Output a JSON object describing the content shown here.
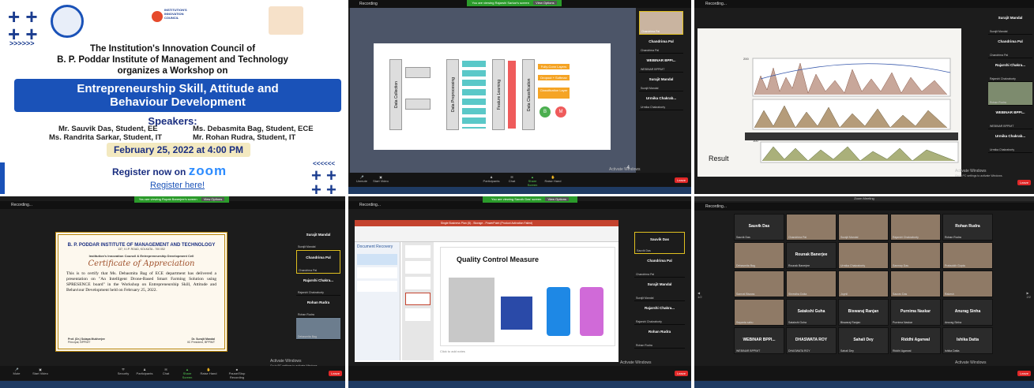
{
  "poster": {
    "title1": "The Institution's Innovation Council of",
    "title2": "B. P. Poddar Institute of Management and Technology",
    "title3": "organizes a Workshop on",
    "banner1": "Entrepreneurship Skill, Attitude and",
    "banner2": "Behaviour Development",
    "speakers_heading": "Speakers:",
    "speakers": [
      "Mr. Sauvik Das, Student, EE",
      "Ms. Debasmita Bag, Student, ECE",
      "Ms. Randrita Sarkar, Student, IT",
      "Mr. Rohan Rudra, Student, IT"
    ],
    "date": "February 25, 2022 at 4:00 PM",
    "register": "Register now on",
    "zoom": "zoom",
    "register_link": "Register here!",
    "iic_logo": "INSTITUTION'S INNOVATION COUNCIL"
  },
  "p2": {
    "share_bar": "You are viewing Rajarshi Sarkar's screen",
    "view_options": "View Options",
    "recording": "Recording",
    "diagram_labels": [
      "Data Collection",
      "Data Preprocessing",
      "Feature Learning",
      "Data Classification"
    ],
    "diagram_boxes": [
      "Fully-Conn Layers",
      "Dropout + Softmax",
      "Classification Layer"
    ],
    "circles": [
      "B",
      "M"
    ],
    "page": "4",
    "participants": [
      {
        "name": "Chandrima Pal",
        "sub": "Chandrima Pal"
      },
      {
        "name": "WEBINAR BPPI...",
        "sub": "WEBINAR BPPIMT"
      },
      {
        "name": "Surajit Mandal",
        "sub": "Surajit Mandal"
      },
      {
        "name": "Urmika Chakrab...",
        "sub": "Urmika Chakraborty"
      }
    ],
    "self": "Chandrima Pal",
    "activate1": "Activate Windows",
    "activate2": "Go to PC settings to activate Windows.",
    "toolbar": [
      "Unmute",
      "Start Video",
      "Participants",
      "Chat",
      "Share Screen",
      "Raise Hand"
    ],
    "leave": "Leave"
  },
  "p3": {
    "recording": "Recording...",
    "result": "Result",
    "tick1": "200",
    "tick2": "100",
    "participants": [
      {
        "name": "Surajit Mandal",
        "sub": "Surajit Mandal"
      },
      {
        "name": "Chandrima Pal",
        "sub": "Chandrima Pal"
      },
      {
        "name": "Rajarshi Chakra...",
        "sub": "Rajarshi Chakraborty"
      },
      {
        "name": "",
        "sub": "Rohan Rudra"
      },
      {
        "name": "WEBINAR BPPI...",
        "sub": "WEBINAR BPPIMT"
      },
      {
        "name": "Urmika Chakrab...",
        "sub": "Urmika Chakraborty"
      }
    ],
    "activate1": "Activate Windows",
    "activate2": "Go to PC settings to activate Windows.",
    "leave": "Leave"
  },
  "p4": {
    "share_bar": "You are viewing Rupak Banerjee's screen",
    "view_options": "View Options",
    "recording": "Recording...",
    "cert_org": "B. P. PODDAR INSTITUTE OF MANAGEMENT AND TECHNOLOGY",
    "cert_addr": "137, V.I.P. ROAD, KOLKATA - 700 052",
    "cert_cell": "Institution's Innovation Council & Entrepreneurship Development Cell",
    "cert_title": "Certificate of Appreciation",
    "cert_body": "This is to certify that Ms. Debasmita Bag of ECE department has delivered a presentation on \"An Intelligent Drone-Based Smart Farming Solution using SPRESENCE board\" in the Workshop on Entrepreneurship Skill, Attitude and Behaviour Development held on February 25, 2022.",
    "sig1": "Prof. (Dr.) Sutapa Mukherjee",
    "sig1_role": "Principal, BPPIMT",
    "sig2": "Dr. Surajit Mandal",
    "sig2_role": "IIC President, BPPIMT",
    "participants": [
      {
        "name": "Surajit Mandal",
        "sub": "Surajit Mandal"
      },
      {
        "name": "Chandrima Pal",
        "sub": "Chandrima Pal"
      },
      {
        "name": "Rajarshi Chakra...",
        "sub": "Rajarshi Chakraborty"
      },
      {
        "name": "Rohan Rudra",
        "sub": "Rohan Rudra"
      },
      {
        "name": "",
        "sub": "Debasmita Bag"
      }
    ],
    "activate1": "Activate Windows",
    "activate2": "Go to PC settings to activate Windows.",
    "leave": "Leave",
    "toolbar": [
      "Mute",
      "Start Video",
      "Security",
      "Participants",
      "Chat",
      "Share Screen",
      "Raise Hand",
      "Pause/Stop Recording"
    ]
  },
  "p5": {
    "share_bar": "You are viewing Sauvik Das' screen",
    "view_options": "View Options",
    "recording": "Recording...",
    "ppt_title": "Single Business Plan (8) - Storage - PowerPoint (Product Activation Failed)",
    "doc_recovery": "Document Recovery",
    "slide_title": "Quality Control Measure",
    "notes": "Click to add notes",
    "participants": [
      {
        "name": "Sauvik Das",
        "sub": "Sauvik Das"
      },
      {
        "name": "Chandrima Pal",
        "sub": "Chandrima Pal"
      },
      {
        "name": "Surajit Mandal",
        "sub": "Surajit Mandal"
      },
      {
        "name": "Rajarshi Chakra...",
        "sub": "Rajarshi Chakraborty"
      },
      {
        "name": "Rohan Rudra",
        "sub": "Rohan Rudra"
      }
    ],
    "activate1": "Activate Windows",
    "activate2": "Go to PC settings to activate Windows.",
    "leave": "Leave"
  },
  "p6": {
    "window_title": "Zoom Meeting",
    "recording": "Recording...",
    "page_left": "1/2",
    "page_right": "2/2",
    "grid": [
      {
        "name": "Sauvik Das",
        "sub": "Sauvik Das",
        "video": false
      },
      {
        "name": "",
        "sub": "Chandrima Pal",
        "video": true
      },
      {
        "name": "",
        "sub": "Surajit Mandal",
        "video": true
      },
      {
        "name": "",
        "sub": "Rajarshi Chakraborty",
        "video": true
      },
      {
        "name": "Rohan Rudra",
        "sub": "Rohan Rudra",
        "video": false
      },
      {
        "name": "",
        "sub": "Debasmita Bag",
        "video": true
      },
      {
        "name": "Rounak Banerjee",
        "sub": "Rounak Banerjee",
        "video": false
      },
      {
        "name": "",
        "sub": "Urmika Chakraborty",
        "video": true
      },
      {
        "name": "",
        "sub": "Sanmay Das",
        "video": true
      },
      {
        "name": "",
        "sub": "Prabuddh Gupta",
        "video": true
      },
      {
        "name": "",
        "sub": "Samrat Biswas",
        "video": true
      },
      {
        "name": "",
        "sub": "Shrestha Dutta",
        "video": true
      },
      {
        "name": "",
        "sub": "Joynil",
        "video": true
      },
      {
        "name": "",
        "sub": "Saurav Das",
        "video": true
      },
      {
        "name": "",
        "sub": "Rakesh",
        "video": true
      },
      {
        "name": "",
        "sub": "Sayanta sahu",
        "video": true
      },
      {
        "name": "Satakshi Guha",
        "sub": "Satakshi Guha",
        "video": false
      },
      {
        "name": "Biswaraj Ranjan",
        "sub": "Biswaraj Ranjan",
        "video": false
      },
      {
        "name": "Purnima Naskar",
        "sub": "Purnima Naskar",
        "video": false
      },
      {
        "name": "Anurag Sinha",
        "sub": "Anurag Sinha",
        "video": false
      },
      {
        "name": "WEBINAR BPPI...",
        "sub": "WEBINAR BPPIMT",
        "video": false
      },
      {
        "name": "DHASWATA ROY",
        "sub": "DHASWATA ROY",
        "video": false
      },
      {
        "name": "Sahali Dey",
        "sub": "Sahali Dey",
        "video": false
      },
      {
        "name": "Riddhi Agarwal",
        "sub": "Riddhi Agarwal",
        "video": false
      },
      {
        "name": "Ishika Datta",
        "sub": "Ishika Datta",
        "video": false
      }
    ],
    "activate1": "Activate Windows",
    "activate2": "Go to PC settings to activate Windows.",
    "leave": "Leave"
  }
}
